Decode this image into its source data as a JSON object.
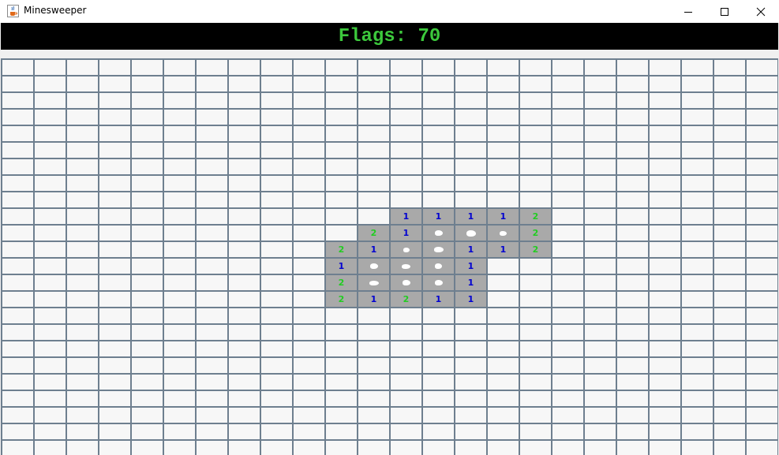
{
  "window": {
    "title": "Minesweeper",
    "icon": "java-cup-icon",
    "controls": [
      "minimize-icon",
      "maximize-icon",
      "close-icon"
    ]
  },
  "status": {
    "flags_text": "Flags: 70",
    "flags_color": "#3cc83c"
  },
  "board": {
    "cols": 24,
    "rows": 25,
    "hidden_color": "#f7f7f7",
    "revealed_color": "#a9a9a9",
    "grid_color": "#6e7f8f",
    "number_colors": {
      "1": "#0000d0",
      "2": "#22cc22"
    },
    "revealed": [
      {
        "r": 9,
        "c": 12,
        "v": "1"
      },
      {
        "r": 9,
        "c": 13,
        "v": "1"
      },
      {
        "r": 9,
        "c": 14,
        "v": "1"
      },
      {
        "r": 9,
        "c": 15,
        "v": "1"
      },
      {
        "r": 9,
        "c": 16,
        "v": "2"
      },
      {
        "r": 10,
        "c": 11,
        "v": "2"
      },
      {
        "r": 10,
        "c": 12,
        "v": "1"
      },
      {
        "r": 10,
        "c": 13,
        "v": ""
      },
      {
        "r": 10,
        "c": 14,
        "v": ""
      },
      {
        "r": 10,
        "c": 15,
        "v": ""
      },
      {
        "r": 10,
        "c": 16,
        "v": "2"
      },
      {
        "r": 11,
        "c": 10,
        "v": "2"
      },
      {
        "r": 11,
        "c": 11,
        "v": "1"
      },
      {
        "r": 11,
        "c": 12,
        "v": ""
      },
      {
        "r": 11,
        "c": 13,
        "v": ""
      },
      {
        "r": 11,
        "c": 14,
        "v": "1"
      },
      {
        "r": 11,
        "c": 15,
        "v": "1"
      },
      {
        "r": 11,
        "c": 16,
        "v": "2"
      },
      {
        "r": 12,
        "c": 10,
        "v": "1"
      },
      {
        "r": 12,
        "c": 11,
        "v": ""
      },
      {
        "r": 12,
        "c": 12,
        "v": ""
      },
      {
        "r": 12,
        "c": 13,
        "v": ""
      },
      {
        "r": 12,
        "c": 14,
        "v": "1"
      },
      {
        "r": 13,
        "c": 10,
        "v": "2"
      },
      {
        "r": 13,
        "c": 11,
        "v": ""
      },
      {
        "r": 13,
        "c": 12,
        "v": ""
      },
      {
        "r": 13,
        "c": 13,
        "v": ""
      },
      {
        "r": 13,
        "c": 14,
        "v": "1"
      },
      {
        "r": 14,
        "c": 10,
        "v": "2"
      },
      {
        "r": 14,
        "c": 11,
        "v": "1"
      },
      {
        "r": 14,
        "c": 12,
        "v": "2"
      },
      {
        "r": 14,
        "c": 13,
        "v": "1"
      },
      {
        "r": 14,
        "c": 14,
        "v": "1"
      }
    ]
  }
}
